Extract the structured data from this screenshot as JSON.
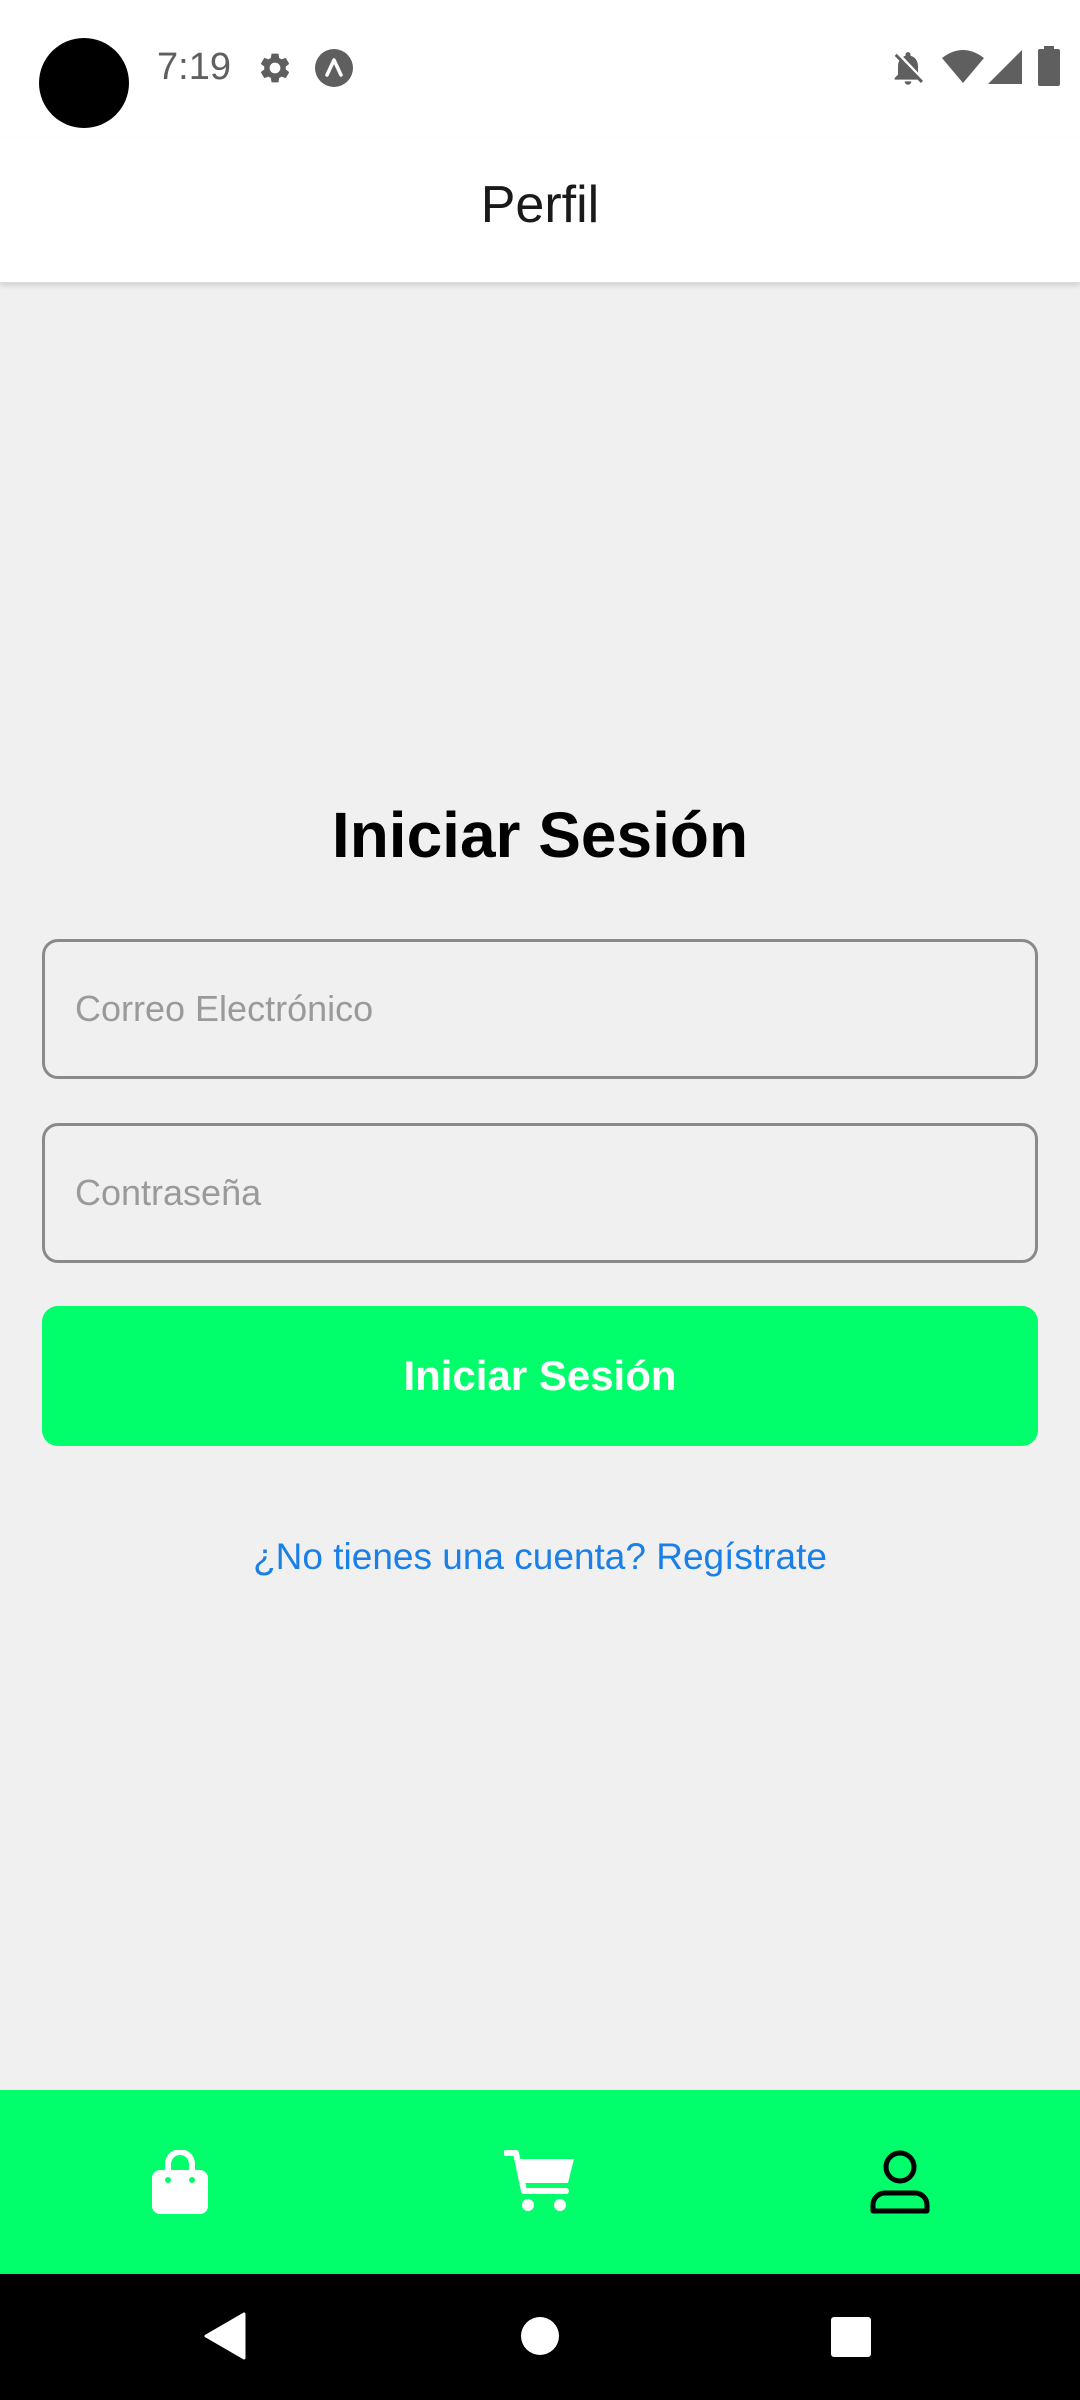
{
  "status_bar": {
    "time": "7:19",
    "icons": [
      "settings-icon",
      "app-notification-icon",
      "notifications-off-icon",
      "wifi-icon",
      "signal-icon",
      "battery-icon"
    ]
  },
  "header": {
    "title": "Perfil"
  },
  "login": {
    "title": "Iniciar Sesión",
    "email_placeholder": "Correo Electrónico",
    "password_placeholder": "Contraseña",
    "submit_label": "Iniciar Sesión",
    "register_link": "¿No tienes una cuenta? Regístrate"
  },
  "bottom_nav": {
    "items": [
      {
        "icon": "shopping-bag-icon",
        "active": false
      },
      {
        "icon": "cart-icon",
        "active": false
      },
      {
        "icon": "profile-icon",
        "active": true
      }
    ]
  },
  "system_nav": {
    "buttons": [
      "back-icon",
      "home-icon",
      "recents-icon"
    ]
  },
  "colors": {
    "accent": "#00ff6a",
    "link": "#1a7fe6",
    "background": "#f0f0f0"
  }
}
